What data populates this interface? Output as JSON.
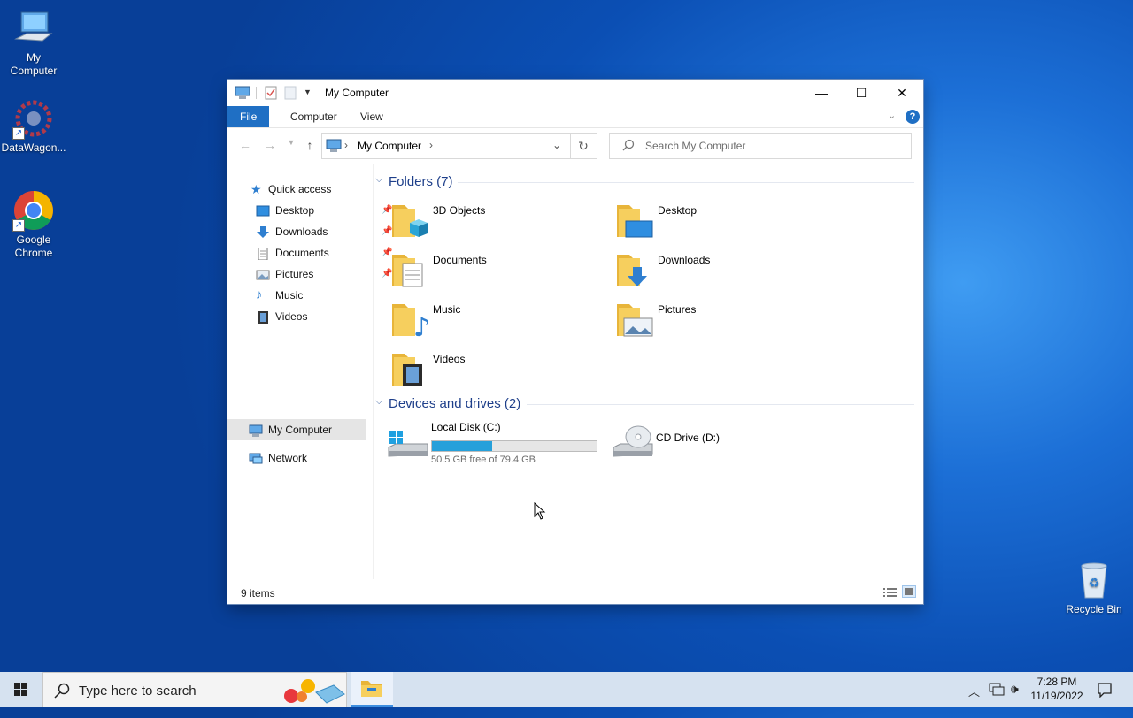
{
  "desktop": {
    "icons": [
      {
        "label_line1": "My",
        "label_line2": "Computer",
        "icon": "computer-icon"
      },
      {
        "label_line1": "DataWagon...",
        "label_line2": "",
        "icon": "datawagon-icon"
      },
      {
        "label_line1": "Google",
        "label_line2": "Chrome",
        "icon": "chrome-icon"
      },
      {
        "label_line1": "Recycle Bin",
        "label_line2": "",
        "icon": "recycle-bin-icon"
      }
    ]
  },
  "window": {
    "title": "My Computer",
    "ribbon_tabs": [
      "File",
      "Computer",
      "View"
    ],
    "address": {
      "location": "My Computer"
    },
    "search": {
      "placeholder": "Search My Computer"
    },
    "nav": {
      "quick_access": "Quick access",
      "items": [
        "Desktop",
        "Downloads",
        "Documents",
        "Pictures",
        "Music",
        "Videos"
      ],
      "my_computer": "My Computer",
      "network": "Network"
    },
    "groups": {
      "folders": "Folders (7)",
      "devices": "Devices and drives (2)"
    },
    "folders": [
      "3D Objects",
      "Desktop",
      "Documents",
      "Downloads",
      "Music",
      "Pictures",
      "Videos"
    ],
    "drives": [
      {
        "name": "Local Disk (C:)",
        "free_text": "50.5 GB free of 79.4 GB",
        "used_fraction": 0.364
      },
      {
        "name": "CD Drive (D:)"
      }
    ],
    "status": "9 items"
  },
  "taskbar": {
    "search_placeholder": "Type here to search",
    "time": "7:28 PM",
    "date": "11/19/2022"
  },
  "colors": {
    "accent": "#1f6fc4",
    "folder": "#f3c34a",
    "disk_bar": "#26a0da"
  }
}
